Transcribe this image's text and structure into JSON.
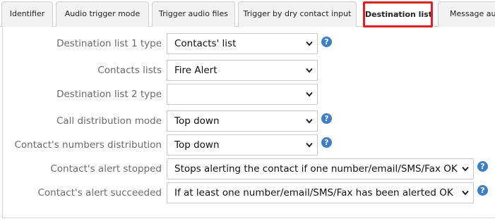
{
  "tabs": [
    {
      "label": "Identifier"
    },
    {
      "label": "Audio trigger mode"
    },
    {
      "label": "Trigger audio files"
    },
    {
      "label": "Trigger by dry contact input"
    },
    {
      "label": "Destination list"
    },
    {
      "label": "Message aud"
    }
  ],
  "form": {
    "dest1_type": {
      "label": "Destination list 1 type",
      "value": "Contacts' list"
    },
    "contacts_lists": {
      "label": "Contacts lists",
      "value": "Fire Alert"
    },
    "dest2_type": {
      "label": "Destination list 2 type",
      "value": ""
    },
    "call_distribution": {
      "label": "Call distribution mode",
      "value": "Top down"
    },
    "numbers_distribution": {
      "label": "Contact's numbers distribution",
      "value": "Top down"
    },
    "alert_stopped": {
      "label": "Contact's alert stopped",
      "value": "Stops alerting the contact if one number/email/SMS/Fax OK"
    },
    "alert_succeeded": {
      "label": "Contact's alert succeeded",
      "value": "If at least one number/email/SMS/Fax has been alerted OK"
    }
  },
  "help_glyph": "?",
  "colors": {
    "active_tab_border": "#e02020",
    "help_icon": "#3d7fc2"
  },
  "icons": [
    "chevron-down-icon",
    "help-icon"
  ]
}
